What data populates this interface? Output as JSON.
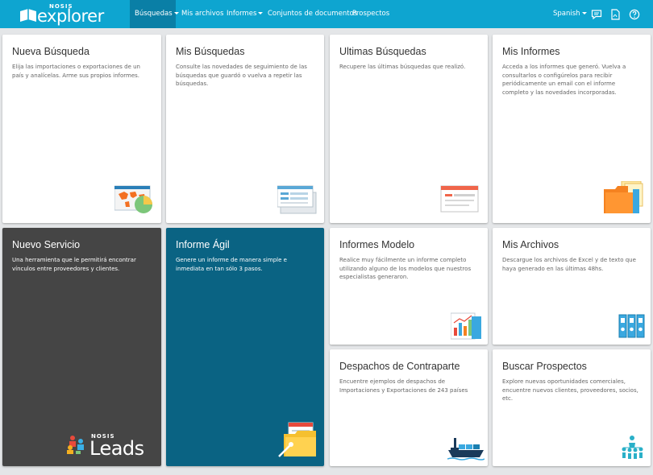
{
  "brand": {
    "prefix": "NOSIS",
    "name": "explorer"
  },
  "nav": {
    "busquedas": "Búsquedas",
    "mis_archivos": "Mis archivos",
    "informes": "Informes",
    "conjuntos": "Conjuntos de documentos",
    "prospectos": "Prospectos",
    "language": "Spanish"
  },
  "icons": {
    "chat": "chat-icon",
    "pdf": "pdf-icon",
    "help": "help-icon"
  },
  "tiles": {
    "nueva_busqueda": {
      "title": "Nueva Búsqueda",
      "desc": "Elija las importaciones o exportaciones de un país y analícelas. Arme sus propios informes."
    },
    "mis_busquedas": {
      "title": "Mis Búsquedas",
      "desc": "Consulte las novedades de seguimiento de las búsquedas que guardó o vuelva a repetir las búsquedas."
    },
    "ultimas_busquedas": {
      "title": "Ultimas Búsquedas",
      "desc": "Recupere las últimas búsquedas que realizó."
    },
    "mis_informes": {
      "title": "Mis Informes",
      "desc": "Acceda a los informes que generó. Vuelva a consultarlos o configúrelos para recibir periódicamente un email con el informe completo y las novedades incorporadas."
    },
    "nuevo_servicio": {
      "title": "Nuevo Servicio",
      "desc": "Una herramienta que le permitirá encontrar vínculos entre proveedores y clientes.",
      "logo_prefix": "NOSIS",
      "logo_word": "Leads"
    },
    "informe_agil": {
      "title": "Informe Ágil",
      "desc": "Genere un informe de manera simple e inmediata en tan sólo 3 pasos."
    },
    "informes_modelo": {
      "title": "Informes Modelo",
      "desc": "Realice muy fácilmente un informe completo utilizando alguno de los modelos que nuestros especialistas generaron."
    },
    "mis_archivos": {
      "title": "Mis Archivos",
      "desc": "Descargue los archivos de Excel y de texto que haya generado en las últimas 48hs."
    },
    "despachos": {
      "title": "Despachos de Contraparte",
      "desc": "Encuentre ejemplos de despachos de Importaciones y Exportaciones de 243 países"
    },
    "buscar_prospectos": {
      "title": "Buscar Prospectos",
      "desc": "Explore nuevas oportunidades comerciales, encuentre nuevos clientes, proveedores, socios, etc."
    }
  },
  "colors": {
    "navbar": "#0ea5d0",
    "nav_active": "#0a7fa6",
    "tile_dark": "#454545",
    "tile_blue": "#0a6383",
    "accent_orange": "#f58220"
  }
}
